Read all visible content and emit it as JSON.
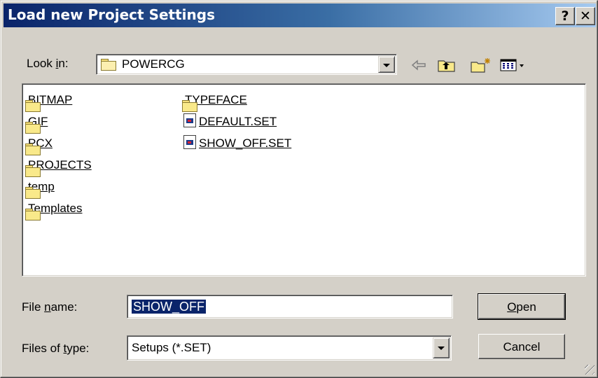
{
  "window": {
    "title": "Load new Project Settings",
    "help_button": "?",
    "close_button": "✕"
  },
  "lookin": {
    "label_pre": "Look ",
    "label_accel": "i",
    "label_post": "n:",
    "value": "POWERCG"
  },
  "files": [
    {
      "name": "BITMAP",
      "kind": "folder"
    },
    {
      "name": "GIF",
      "kind": "folder"
    },
    {
      "name": "PCX",
      "kind": "folder"
    },
    {
      "name": "PROJECTS",
      "kind": "folder"
    },
    {
      "name": "temp",
      "kind": "folder"
    },
    {
      "name": "Templates",
      "kind": "folder"
    },
    {
      "name": "TYPEFACE",
      "kind": "folder"
    },
    {
      "name": "DEFAULT.SET",
      "kind": "file"
    },
    {
      "name": "SHOW_OFF.SET",
      "kind": "file"
    }
  ],
  "filename": {
    "label_pre": "File ",
    "label_accel": "n",
    "label_post": "ame:",
    "value": "SHOW_OFF"
  },
  "filetype": {
    "label_pre": "Files of ",
    "label_accel": "t",
    "label_post": "ype:",
    "value": "Setups (*.SET)"
  },
  "buttons": {
    "open_accel": "O",
    "open_rest": "pen",
    "cancel": "Cancel"
  },
  "icons": [
    "folder-icon",
    "back-arrow-icon",
    "up-folder-icon",
    "new-folder-icon",
    "view-menu-icon"
  ],
  "colors": {
    "title_start": "#0a246a",
    "title_end": "#a6caf0",
    "face": "#d4d0c8",
    "selection": "#0a246a"
  }
}
